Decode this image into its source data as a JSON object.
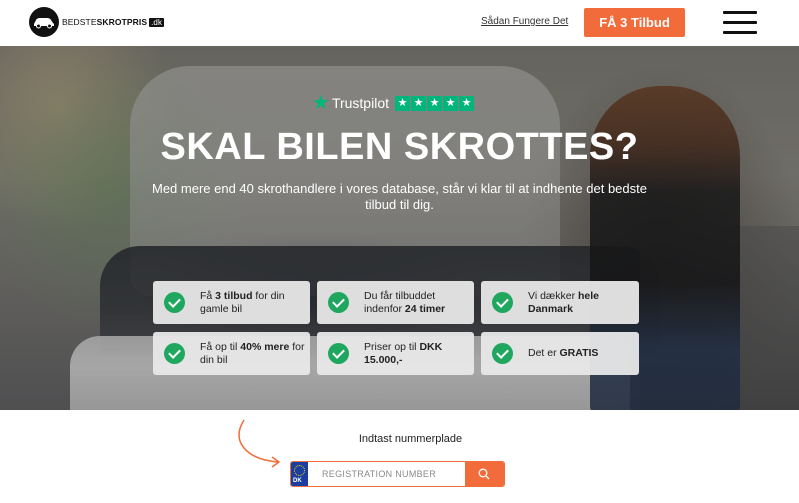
{
  "header": {
    "logo": {
      "part1": "BEDSTE",
      "part2": "SKROTPRIS",
      "tld": ".dk"
    },
    "nav_link": "Sådan Fungere Det",
    "cta_label": "FÅ 3 Tilbud",
    "menu_icon": "hamburger-icon"
  },
  "hero": {
    "trustpilot": {
      "name": "Trustpilot",
      "stars": 5,
      "star_color": "#00b67a"
    },
    "title": "SKAL BILEN SKROTTES?",
    "subtitle": "Med mere end 40 skrothandlere i vores database, står vi klar til at indhente det bedste tilbud til dig.",
    "features": [
      {
        "pre": "Få ",
        "bold": "3 tilbud",
        "post": " for din gamle bil"
      },
      {
        "pre": "Du får tilbuddet indenfor ",
        "bold": "24 timer",
        "post": ""
      },
      {
        "pre": "Vi dækker ",
        "bold": "hele Danmark",
        "post": ""
      },
      {
        "pre": "Få op til ",
        "bold": "40% mere",
        "post": " for din bil"
      },
      {
        "pre": "Priser op til ",
        "bold": "DKK 15.000,-",
        "post": ""
      },
      {
        "pre": "Det er ",
        "bold": "GRATIS",
        "post": ""
      }
    ]
  },
  "plate": {
    "label": "Indtast nummerplade",
    "country": "DK",
    "placeholder": "REGISTRATION NUMBER",
    "search_icon": "search-icon"
  },
  "colors": {
    "accent": "#f26b3a",
    "check": "#1fa760",
    "eu_blue": "#1b3fa0"
  }
}
